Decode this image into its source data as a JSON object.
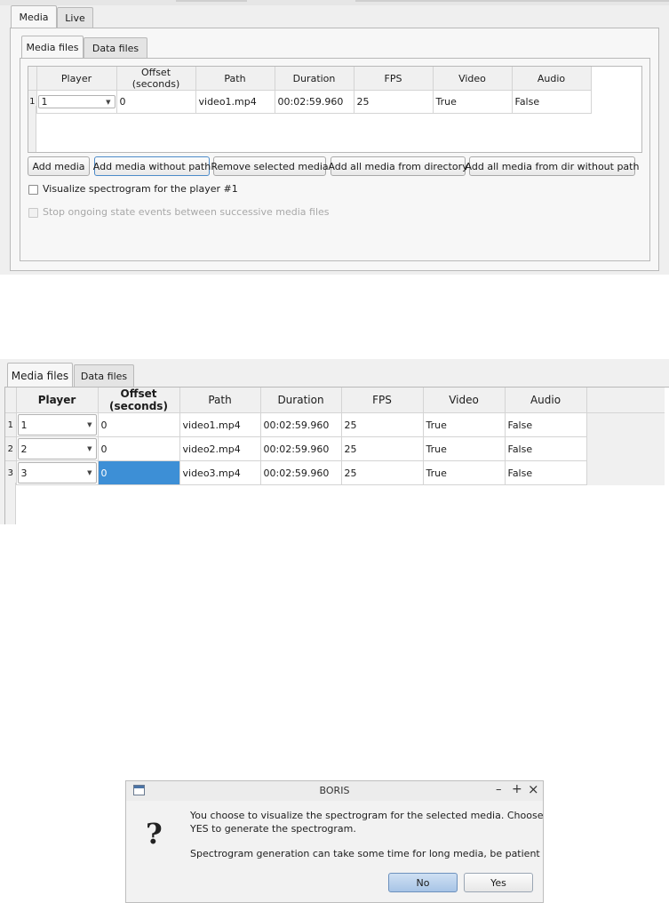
{
  "panel1": {
    "outer_tabs": [
      "Media",
      "Live"
    ],
    "inner_tabs": [
      "Media files",
      "Data files"
    ],
    "columns": [
      "Player",
      "Offset (seconds)",
      "Path",
      "Duration",
      "FPS",
      "Video",
      "Audio"
    ],
    "rows": [
      {
        "num": "1",
        "player": "1",
        "offset": "0",
        "path": "video1.mp4",
        "duration": "00:02:59.960",
        "fps": "25",
        "video": "True",
        "audio": "False"
      }
    ],
    "buttons": {
      "add_media": "Add media",
      "add_without_path": "Add media without path",
      "remove_selected": "Remove selected media",
      "add_from_dir": "Add all media from directory",
      "add_from_dir_without_path": "Add all media from dir without path"
    },
    "checkbox_spectrogram": "Visualize spectrogram for the player #1",
    "checkbox_stop_events": "Stop ongoing state events between successive media files"
  },
  "panel2": {
    "inner_tabs": [
      "Media files",
      "Data files"
    ],
    "columns": [
      "Player",
      "Offset (seconds)",
      "Path",
      "Duration",
      "FPS",
      "Video",
      "Audio"
    ],
    "rows": [
      {
        "num": "1",
        "player": "1",
        "offset": "0",
        "path": "video1.mp4",
        "duration": "00:02:59.960",
        "fps": "25",
        "video": "True",
        "audio": "False"
      },
      {
        "num": "2",
        "player": "2",
        "offset": "0",
        "path": "video2.mp4",
        "duration": "00:02:59.960",
        "fps": "25",
        "video": "True",
        "audio": "False"
      },
      {
        "num": "3",
        "player": "3",
        "offset": "0",
        "path": "video3.mp4",
        "duration": "00:02:59.960",
        "fps": "25",
        "video": "True",
        "audio": "False"
      }
    ]
  },
  "dialog": {
    "title": "BORIS",
    "controls": {
      "minimize": "–",
      "maximize": "+",
      "close": "×"
    },
    "message_line1": "You choose to visualize the spectrogram for the selected media. Choose",
    "message_line2": "YES to generate the spectrogram.",
    "message_line3": "Spectrogram generation can take some time for long media, be patient",
    "no_label": "No",
    "yes_label": "Yes"
  }
}
